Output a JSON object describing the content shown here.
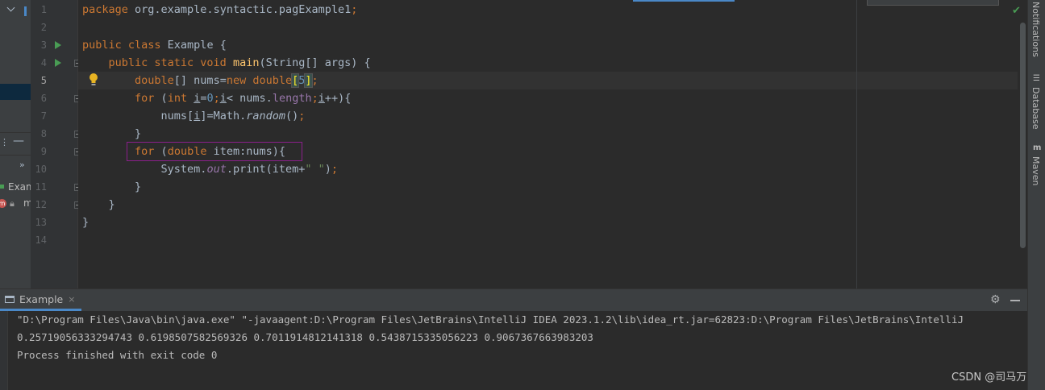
{
  "editor": {
    "line_numbers": [
      "1",
      "2",
      "3",
      "4",
      "5",
      "6",
      "7",
      "8",
      "9",
      "10",
      "11",
      "12",
      "13",
      "14"
    ],
    "current_line": "5",
    "lines": [
      {
        "tokens": [
          {
            "t": "package ",
            "c": "kw"
          },
          {
            "t": "org.example.syntactic.pagExample1",
            "c": ""
          },
          {
            "t": ";",
            "c": "kw"
          }
        ]
      },
      {
        "tokens": []
      },
      {
        "tokens": [
          {
            "t": "public class ",
            "c": "kw"
          },
          {
            "t": "Example {",
            "c": ""
          }
        ]
      },
      {
        "tokens": [
          {
            "t": "    public static void ",
            "c": "kw"
          },
          {
            "t": "main",
            "c": "fn"
          },
          {
            "t": "(String[] args) {",
            "c": ""
          }
        ]
      },
      {
        "tokens": [
          {
            "t": "        double",
            "c": "kw"
          },
          {
            "t": "[] nums=",
            "c": ""
          },
          {
            "t": "new double",
            "c": "kw"
          },
          {
            "t": "[",
            "c": "brk"
          },
          {
            "t": "5",
            "c": "num"
          },
          {
            "t": "]",
            "c": "brk"
          },
          {
            "t": ";",
            "c": "kw"
          }
        ]
      },
      {
        "tokens": [
          {
            "t": "        for ",
            "c": "kw"
          },
          {
            "t": "(",
            "c": ""
          },
          {
            "t": "int ",
            "c": "kw"
          },
          {
            "t": "i",
            "c": "ul"
          },
          {
            "t": "=",
            "c": ""
          },
          {
            "t": "0",
            "c": "num"
          },
          {
            "t": ";",
            "c": "kw"
          },
          {
            "t": "i",
            "c": "ul"
          },
          {
            "t": "< nums.",
            "c": ""
          },
          {
            "t": "length",
            "c": "fld"
          },
          {
            "t": ";",
            "c": "kw"
          },
          {
            "t": "i",
            "c": "ul"
          },
          {
            "t": "++){",
            "c": ""
          }
        ]
      },
      {
        "tokens": [
          {
            "t": "            nums[",
            "c": ""
          },
          {
            "t": "i",
            "c": "ul"
          },
          {
            "t": "]=Math.",
            "c": ""
          },
          {
            "t": "random",
            "c": "it"
          },
          {
            "t": "()",
            "c": ""
          },
          {
            "t": ";",
            "c": "kw"
          }
        ]
      },
      {
        "tokens": [
          {
            "t": "        }",
            "c": ""
          }
        ]
      },
      {
        "tokens": [
          {
            "t": "        for ",
            "c": "kw"
          },
          {
            "t": "(",
            "c": ""
          },
          {
            "t": "double ",
            "c": "kw"
          },
          {
            "t": "item:nums){",
            "c": ""
          }
        ]
      },
      {
        "tokens": [
          {
            "t": "            System.",
            "c": ""
          },
          {
            "t": "out",
            "c": "fld it"
          },
          {
            "t": ".print(item+",
            "c": ""
          },
          {
            "t": "\" \"",
            "c": "str"
          },
          {
            "t": ")",
            "c": ""
          },
          {
            "t": ";",
            "c": "kw"
          }
        ]
      },
      {
        "tokens": [
          {
            "t": "        }",
            "c": ""
          }
        ]
      },
      {
        "tokens": [
          {
            "t": "    }",
            "c": ""
          }
        ]
      },
      {
        "tokens": [
          {
            "t": "}",
            "c": ""
          }
        ]
      },
      {
        "tokens": []
      }
    ]
  },
  "project_panel": {
    "expand_label": "»",
    "tree_item_1": "Exam",
    "tree_item_2": "m"
  },
  "right_tool_tabs": {
    "notifications": "Notifications",
    "database": "Database",
    "maven": "Maven"
  },
  "run_window": {
    "tab_label": "Example",
    "close_glyph": "×",
    "gear_glyph": "⚙",
    "console_lines": [
      "\"D:\\Program Files\\Java\\bin\\java.exe\" \"-javaagent:D:\\Program Files\\JetBrains\\IntelliJ IDEA 2023.1.2\\lib\\idea_rt.jar=62823:D:\\Program Files\\JetBrains\\IntelliJ",
      "0.25719056333294743 0.6198507582569326 0.7011914812141318 0.5438715335056223 0.9067367663983203",
      "Process finished with exit code 0"
    ]
  },
  "status": {
    "inspection_glyph": "✔"
  },
  "watermark": "CSDN @司马万",
  "colors": {
    "keyword": "#cc7832",
    "method": "#ffc66d",
    "number": "#6897bb",
    "string": "#6a8759",
    "field": "#9876aa",
    "highlight_box": "#8c1f8c",
    "run_icon": "#499c54"
  }
}
